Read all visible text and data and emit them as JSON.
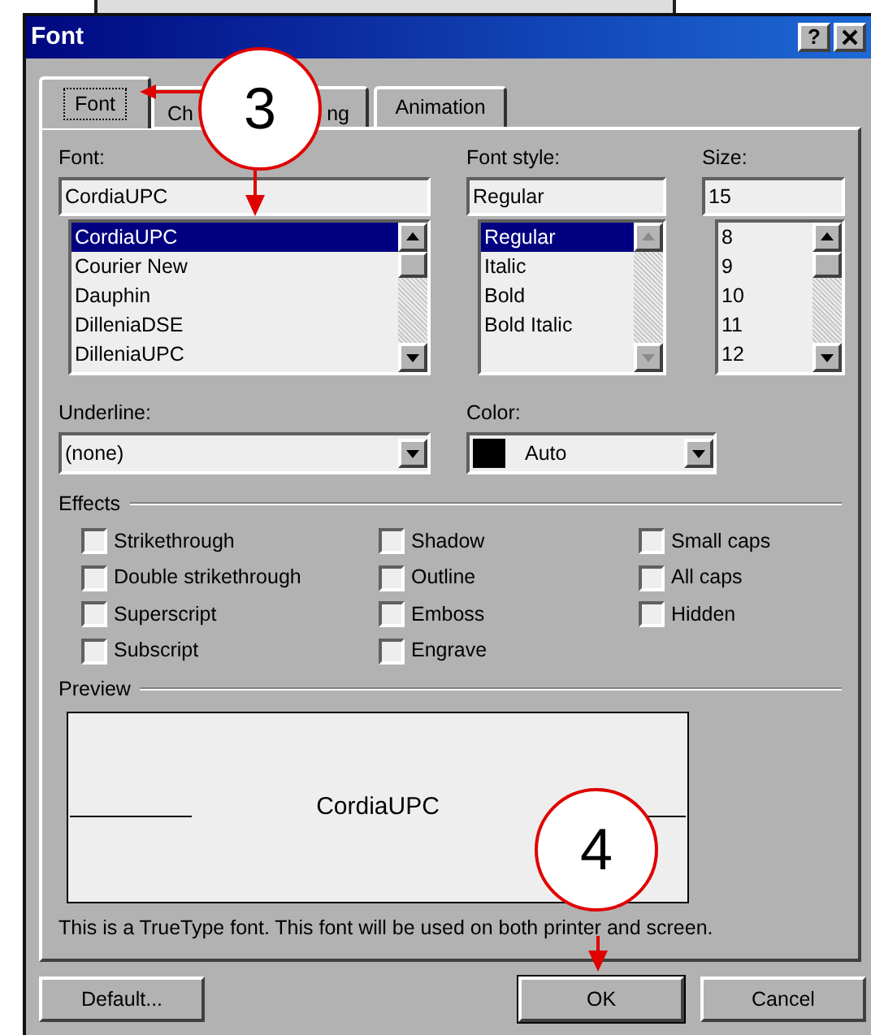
{
  "window": {
    "title": "Font",
    "help_button": "?"
  },
  "tabs": [
    {
      "label": "Font",
      "selected": true
    },
    {
      "label_start": "Ch",
      "label_end": "ng",
      "selected": false
    },
    {
      "label": "Animation",
      "selected": false
    }
  ],
  "font": {
    "label": "Font:",
    "value": "CordiaUPC",
    "scroll_disabled": false,
    "items": [
      {
        "text": "CordiaUPC",
        "selected": true
      },
      {
        "text": "Courier New",
        "selected": false
      },
      {
        "text": "Dauphin",
        "selected": false
      },
      {
        "text": "DilleniaDSE",
        "selected": false
      },
      {
        "text": "DilleniaUPC",
        "selected": false
      }
    ]
  },
  "font_style": {
    "label": "Font style:",
    "value": "Regular",
    "scroll_disabled": true,
    "items": [
      {
        "text": "Regular",
        "selected": true
      },
      {
        "text": "Italic",
        "selected": false
      },
      {
        "text": "Bold",
        "selected": false
      },
      {
        "text": "Bold Italic",
        "selected": false
      }
    ]
  },
  "size": {
    "label": "Size:",
    "value": "15",
    "scroll_disabled": false,
    "items": [
      {
        "text": "8",
        "selected": false
      },
      {
        "text": "9",
        "selected": false
      },
      {
        "text": "10",
        "selected": false
      },
      {
        "text": "11",
        "selected": false
      },
      {
        "text": "12",
        "selected": false
      }
    ]
  },
  "underline": {
    "label": "Underline:",
    "value": "(none)"
  },
  "color": {
    "label": "Color:",
    "value": "Auto"
  },
  "effects": {
    "legend": "Effects",
    "columns": [
      [
        {
          "label": "Strikethrough",
          "checked": false
        },
        {
          "label": "Double strikethrough",
          "checked": false
        },
        {
          "label": "Superscript",
          "checked": false
        },
        {
          "label": "Subscript",
          "checked": false
        }
      ],
      [
        {
          "label": "Shadow",
          "checked": false
        },
        {
          "label": "Outline",
          "checked": false
        },
        {
          "label": "Emboss",
          "checked": false
        },
        {
          "label": "Engrave",
          "checked": false
        }
      ],
      [
        {
          "label": "Small caps",
          "checked": false
        },
        {
          "label": "All caps",
          "checked": false
        },
        {
          "label": "Hidden",
          "checked": false
        }
      ]
    ]
  },
  "preview": {
    "legend": "Preview",
    "sample": "CordiaUPC"
  },
  "description": "This is a TrueType font. This font will be used on both printer and screen.",
  "buttons": [
    {
      "label": "Default...",
      "default": false
    },
    {
      "label": "OK",
      "default": true
    },
    {
      "label": "Cancel",
      "default": false
    }
  ],
  "callouts": [
    {
      "number": "3"
    },
    {
      "number": "4"
    }
  ]
}
